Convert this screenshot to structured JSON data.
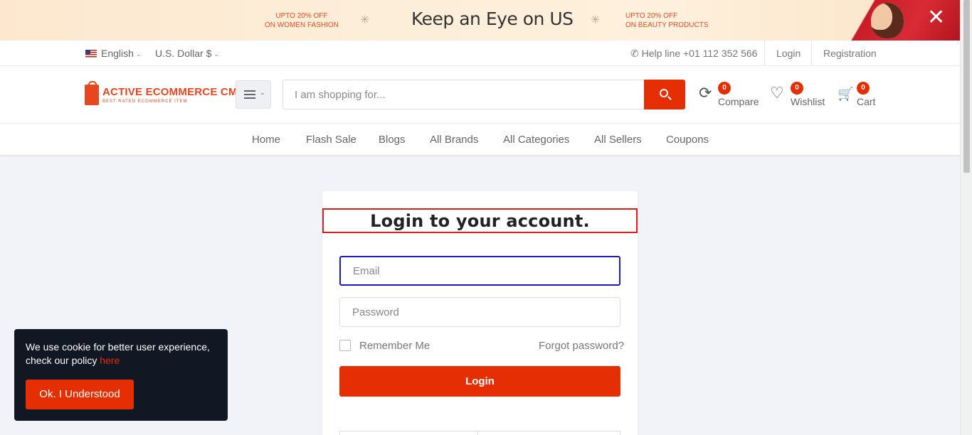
{
  "banner": {
    "promo_left_line1": "UPTO 20% OFF",
    "promo_left_line2": "ON WOMEN FASHION",
    "headline": "Keep an Eye on US",
    "promo_right_line1": "UPTO 20% OFF",
    "promo_right_line2": "ON BEAUTY PRODUCTS",
    "star_glyph": "✳",
    "close_glyph": "✕"
  },
  "topbar": {
    "language": "English",
    "currency": "U.S. Dollar $",
    "helpline": "Help line +01 112 352 566",
    "login": "Login",
    "registration": "Registration"
  },
  "header": {
    "logo_name": "ACTIVE ECOMMERCE CMS",
    "logo_tagline": "BEST RATED ECOMMERCE ITEM",
    "search_placeholder": "I am shopping for...",
    "compare": {
      "label": "Compare",
      "count": "0",
      "icon": "refresh-icon"
    },
    "wishlist": {
      "label": "Wishlist",
      "count": "0",
      "icon": "heart-icon"
    },
    "cart": {
      "label": "Cart",
      "count": "0",
      "icon": "cart-icon"
    }
  },
  "nav": {
    "items": [
      "Home",
      "Flash Sale",
      "Blogs",
      "All Brands",
      "All Categories",
      "All Sellers",
      "Coupons"
    ]
  },
  "login_card": {
    "title": "Login to your account.",
    "email_placeholder": "Email",
    "password_placeholder": "Password",
    "remember_label": "Remember Me",
    "forgot_label": "Forgot password?",
    "login_button": "Login"
  },
  "cookie": {
    "message": "We use cookie for better user experience, check our policy ",
    "link_text": "here",
    "button": "Ok. I Understood"
  },
  "colors": {
    "accent": "#e62e04",
    "highlight_border": "#e01b1b",
    "focus_border": "#1a1ac4",
    "cookie_bg": "#111723"
  }
}
